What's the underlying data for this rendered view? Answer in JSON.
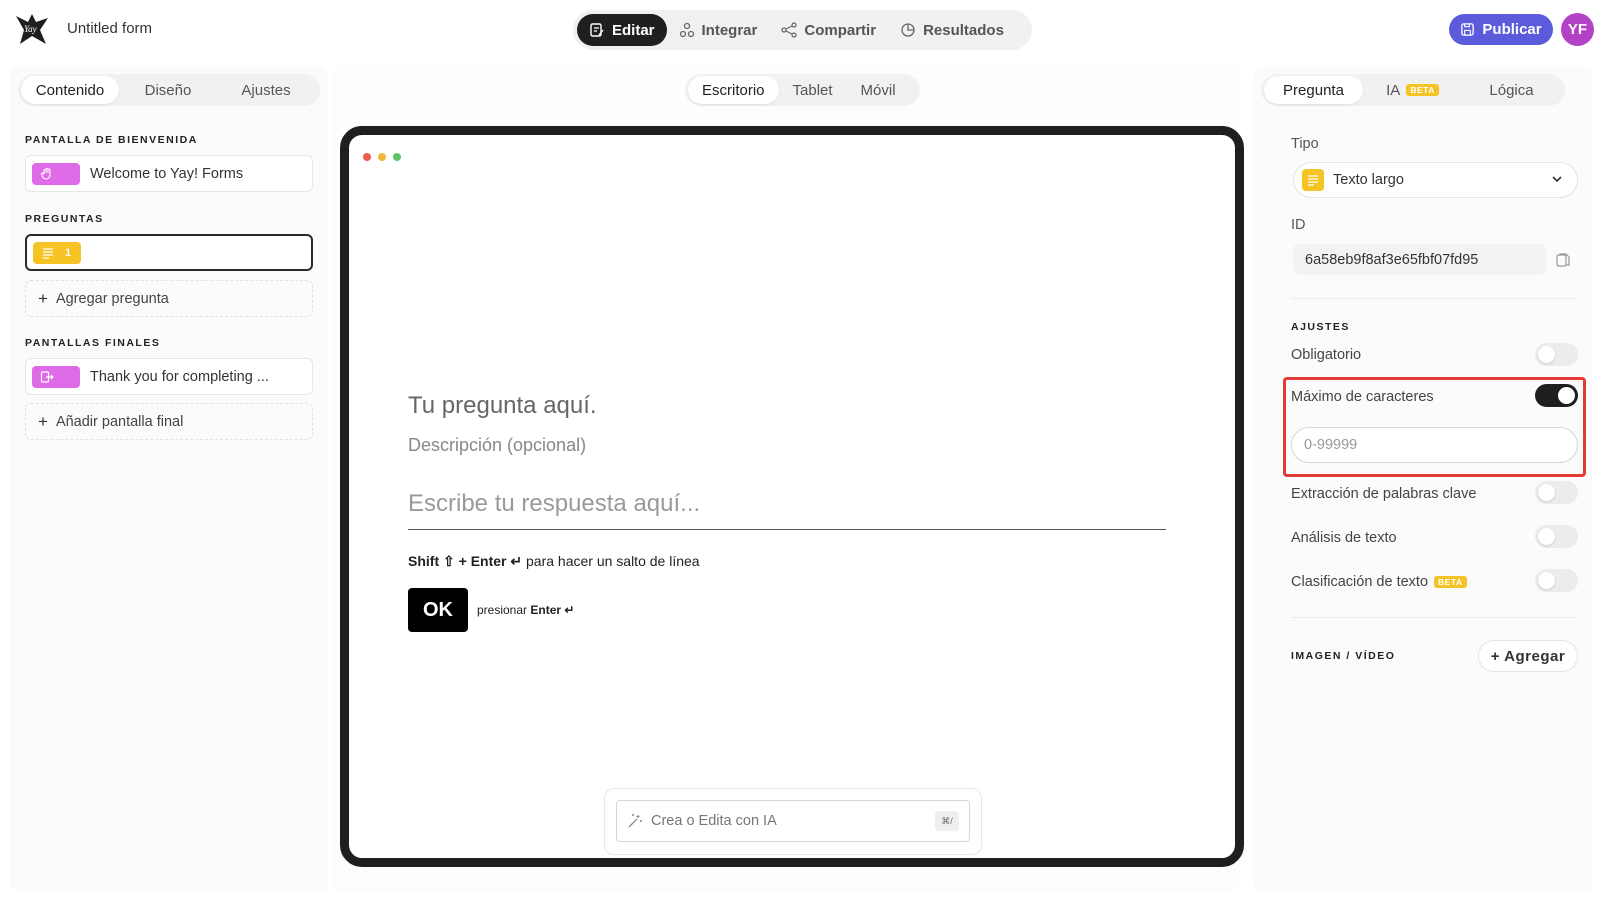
{
  "app": {
    "form_title": "Untitled form",
    "avatar_initials": "YF",
    "publish_label": "Publicar"
  },
  "topnav": [
    {
      "label": "Editar",
      "icon": "edit-icon",
      "active": true
    },
    {
      "label": "Integrar",
      "icon": "integrate-icon",
      "active": false
    },
    {
      "label": "Compartir",
      "icon": "share-icon",
      "active": false
    },
    {
      "label": "Resultados",
      "icon": "results-icon",
      "active": false
    }
  ],
  "left": {
    "tabs": [
      "Contenido",
      "Diseño",
      "Ajustes"
    ],
    "welcome_section": "PANTALLA DE BIENVENIDA",
    "welcome_item": "Welcome to Yay! Forms",
    "questions_section": "PREGUNTAS",
    "question_number": "1",
    "add_question": "Agregar pregunta",
    "endings_section": "PANTALLAS FINALES",
    "ending_item": "Thank you for completing ...",
    "add_ending": "Añadir pantalla final"
  },
  "center": {
    "device_tabs": [
      "Escritorio",
      "Tablet",
      "Móvil"
    ],
    "question_title": "Tu pregunta aquí.",
    "question_description": "Descripción (opcional)",
    "answer_placeholder": "Escribe tu respuesta aquí...",
    "hint_shift": "Shift ⇧",
    "hint_enter": "+ Enter ↵",
    "hint_rest": "para hacer un salto de línea",
    "ok_label": "OK",
    "press_prefix": "presionar",
    "press_key": "Enter ↵",
    "ai_placeholder": "Crea o Edita con IA",
    "ai_shortcut": "⌘/"
  },
  "right": {
    "tabs": [
      "Pregunta",
      "IA",
      "Lógica"
    ],
    "beta_badge": "BETA",
    "type_label": "Tipo",
    "type_value": "Texto largo",
    "id_label": "ID",
    "id_value": "6a58eb9f8af3e65fbf07fd95",
    "settings_section": "AJUSTES",
    "settings": {
      "required": "Obligatorio",
      "max_chars": "Máximo de caracteres",
      "max_chars_placeholder": "0-99999",
      "keyword_extraction": "Extracción de palabras clave",
      "text_analysis": "Análisis de texto",
      "text_classification": "Clasificación de texto"
    },
    "media_section": "IMAGEN / VÍDEO",
    "add_media": "+ Agregar"
  },
  "colors": {
    "accent": "#5b5bdc",
    "avatar": "#b442c7",
    "pink_badge": "#e06be8",
    "yellow_badge": "#f6c324",
    "highlight": "#e53935"
  }
}
